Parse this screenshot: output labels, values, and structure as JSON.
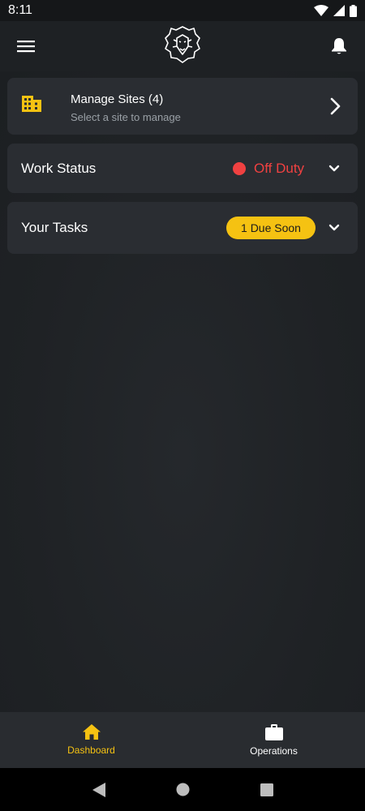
{
  "status_bar": {
    "time": "8:11"
  },
  "sites_card": {
    "title": "Manage Sites (4)",
    "subtitle": "Select a site to manage"
  },
  "work_status": {
    "label": "Work Status",
    "value": "Off Duty"
  },
  "tasks": {
    "label": "Your Tasks",
    "badge": "1 Due Soon"
  },
  "bottom_nav": {
    "items": [
      {
        "label": "Dashboard",
        "icon": "home-icon",
        "active": true
      },
      {
        "label": "Operations",
        "icon": "briefcase-icon",
        "active": false
      }
    ]
  },
  "colors": {
    "accent": "#f5c212",
    "danger": "#f04141",
    "card": "#2a2d32",
    "background": "#1e2124"
  }
}
